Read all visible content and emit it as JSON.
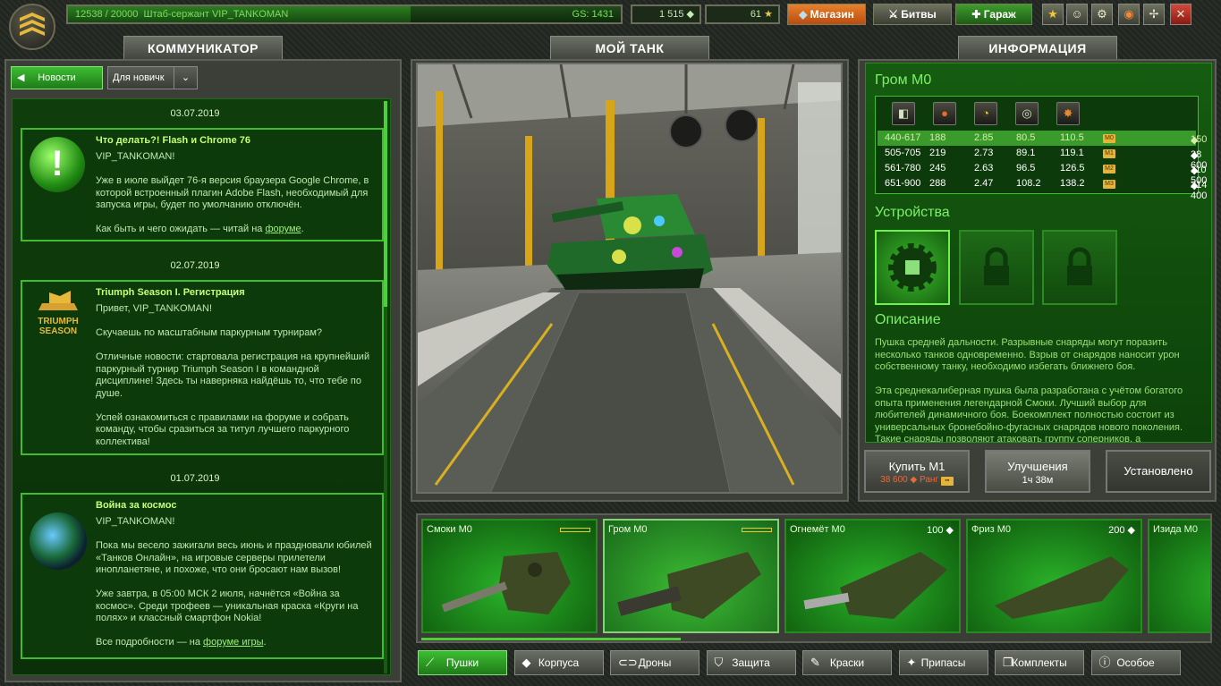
{
  "topbar": {
    "xp": "12538 / 20000",
    "rank_name": "Штаб-сержант VIP_TANKOMAN",
    "gs": "GS: 1431",
    "crystals": "1 515",
    "stars": "61",
    "shop_label": "Магазин",
    "battles_label": "Битвы",
    "garage_label": "Гараж"
  },
  "tabs": {
    "left": "КОММУНИКАТОР",
    "middle": "МОЙ ТАНК",
    "right": "ИНФОРМАЦИЯ"
  },
  "communicator": {
    "news_btn": "Новости",
    "filter": "Для новичк",
    "posts": [
      {
        "date": "03.07.2019",
        "title": "Что делать?! Flash и Chrome 76",
        "text": "VIP_TANKOMAN!\n\nУже в июле выйдет 76-я версия браузера Google Chrome, в которой встроенный плагин Adobe Flash, необходимый для запуска игры, будет по умолчанию отключён.\n\nКак быть и чего ожидать — читай на ",
        "link": "форуме",
        "tail": "."
      },
      {
        "date": "02.07.2019",
        "title": "Triumph Season I. Регистрация",
        "text": "Привет, VIP_TANKOMAN!\n\nСкучаешь по масштабным паркурным турнирам?\n\nОтличные новости: стартовала регистрация  на крупнейший паркурный турнир Triumph Season I в командной дисциплине! Здесь ты наверняка найдёшь то, что тебе по душе.\n\nУспей ознакомиться с  правилами на форуме  и собрать команду, чтобы сразиться за титул лучшего паркурного коллектива!",
        "link": "",
        "tail": "",
        "logo": "TRIUMPH SEASON"
      },
      {
        "date": "01.07.2019",
        "title": "Война за космос",
        "text": "VIP_TANKOMAN!\n\nПока мы весело зажигали весь июнь и праздновали юбилей «Танков Онлайн», на игровые серверы прилетели инопланетяне, и похоже, что они бросают нам вызов!\n\nУже завтра, в 05:00 МСК 2 июля, начнётся «Война за космос». Среди трофеев — уникальная краска «Круги на полях» и классный смартфон Nokia!\n\nВсе подробности — на ",
        "link": "форуме игры",
        "tail": "."
      }
    ]
  },
  "info": {
    "title": "Гром М0",
    "stats_rows": [
      {
        "range": "440-617",
        "dmg": "188",
        "reload": "2.85",
        "rot": "80.5",
        "impact": "110.5",
        "mod": "M0",
        "price": "150",
        "current": true
      },
      {
        "range": "505-705",
        "dmg": "219",
        "reload": "2.73",
        "rot": "89.1",
        "impact": "119.1",
        "mod": "M1",
        "price": "38 600"
      },
      {
        "range": "561-780",
        "dmg": "245",
        "reload": "2.63",
        "rot": "96.5",
        "impact": "126.5",
        "mod": "M2",
        "price": "110 500"
      },
      {
        "range": "651-900",
        "dmg": "288",
        "reload": "2.47",
        "rot": "108.2",
        "impact": "138.2",
        "mod": "M3",
        "price": "214 400"
      }
    ],
    "devices_title": "Устройства",
    "desc_title": "Описание",
    "desc": "Пушка средней дальности. Разрывные снаряды могут поразить несколько танков одновременно. Взрыв от снарядов наносит урон собственному танку, необходимо избегать ближнего боя.\n\nЭта среднекалиберная пушка была разработана с учётом богатого опыта применения легендарной Смоки. Лучший выбор для любителей динамичного боя. Боекомплект полностью состоит из универсальных бронебойно-фугасных снарядов нового поколения. Такие снаряды позволяют атаковать группу соперников, а",
    "buy_label": "Купить М1",
    "buy_price": "38 600",
    "buy_rank": "Ранг",
    "upgrade_label": "Улучшения",
    "upgrade_time": "1ч 38м",
    "installed_label": "Установлено"
  },
  "items": [
    {
      "name": "Смоки М0",
      "price": ""
    },
    {
      "name": "Гром М0",
      "price": ""
    },
    {
      "name": "Огнемёт М0",
      "price": "100"
    },
    {
      "name": "Фриз М0",
      "price": "200"
    },
    {
      "name": "Изида М0",
      "price": ""
    }
  ],
  "categories": [
    "Пушки",
    "Корпуса",
    "Дроны",
    "Защита",
    "Краски",
    "Припасы",
    "Комплекты",
    "Особое"
  ]
}
